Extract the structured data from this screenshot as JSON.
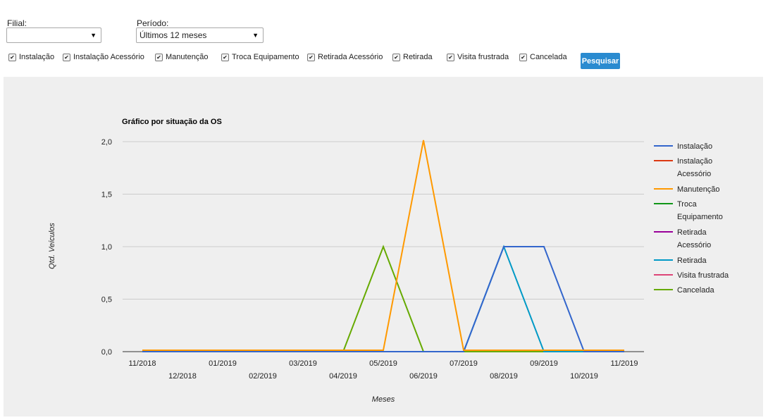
{
  "filters": {
    "filial_label": "Filial:",
    "filial_value": "",
    "periodo_label": "Período:",
    "periodo_value": "Últimos 12 meses"
  },
  "checkboxes": [
    {
      "label": "Instalação",
      "checked": true
    },
    {
      "label": "Instalação Acessório",
      "checked": true
    },
    {
      "label": "Manutenção",
      "checked": true
    },
    {
      "label": "Troca Equipamento",
      "checked": true
    },
    {
      "label": "Retirada Acessório",
      "checked": true
    },
    {
      "label": "Retirada",
      "checked": true
    },
    {
      "label": "Visita frustrada",
      "checked": true
    },
    {
      "label": "Cancelada",
      "checked": true
    }
  ],
  "search_button": "Pesquisar",
  "chart_data": {
    "type": "line",
    "title": "Gráfico por situação da OS",
    "xlabel": "Meses",
    "ylabel": "Qtd. Veículos",
    "categories": [
      "11/2018",
      "12/2018",
      "01/2019",
      "02/2019",
      "03/2019",
      "04/2019",
      "05/2019",
      "06/2019",
      "07/2019",
      "08/2019",
      "09/2019",
      "10/2019",
      "11/2019"
    ],
    "yticks": [
      "0,0",
      "0,5",
      "1,0",
      "1,5",
      "2,0"
    ],
    "ylim": [
      0,
      2
    ],
    "grid": true,
    "legend_position": "right",
    "series": [
      {
        "name": "Instalação",
        "legend_lines": [
          "Instalação"
        ],
        "color": "#3366cc",
        "values": [
          0,
          0,
          0,
          0,
          0,
          0,
          0,
          0,
          0,
          1,
          1,
          0,
          0
        ]
      },
      {
        "name": "Instalação Acessório",
        "legend_lines": [
          "Instalação",
          "Acessório"
        ],
        "color": "#dc3912",
        "values": [
          0,
          0,
          0,
          0,
          0,
          0,
          0,
          0,
          0,
          0,
          0,
          0,
          0
        ]
      },
      {
        "name": "Manutenção",
        "legend_lines": [
          "Manutenção"
        ],
        "color": "#ff9900",
        "values": [
          0,
          0,
          0,
          0,
          0,
          0,
          0,
          2,
          0,
          0,
          0,
          0,
          0
        ]
      },
      {
        "name": "Troca Equipamento",
        "legend_lines": [
          "Troca",
          "Equipamento"
        ],
        "color": "#109618",
        "values": [
          0,
          0,
          0,
          0,
          0,
          0,
          0,
          0,
          0,
          0,
          0,
          0,
          0
        ]
      },
      {
        "name": "Retirada Acessório",
        "legend_lines": [
          "Retirada",
          "Acessório"
        ],
        "color": "#990099",
        "values": [
          0,
          0,
          0,
          0,
          0,
          0,
          0,
          0,
          0,
          0,
          0,
          0,
          0
        ]
      },
      {
        "name": "Retirada",
        "legend_lines": [
          "Retirada"
        ],
        "color": "#0099c6",
        "values": [
          0,
          0,
          0,
          0,
          0,
          0,
          0,
          0,
          0,
          1,
          0,
          0,
          0
        ]
      },
      {
        "name": "Visita frustrada",
        "legend_lines": [
          "Visita frustrada"
        ],
        "color": "#dd4477",
        "values": [
          0,
          0,
          0,
          0,
          0,
          0,
          0,
          0,
          0,
          0,
          0,
          0,
          0
        ]
      },
      {
        "name": "Cancelada",
        "legend_lines": [
          "Cancelada"
        ],
        "color": "#66aa00",
        "values": [
          0,
          0,
          0,
          0,
          0,
          0,
          1,
          0,
          0,
          0,
          0,
          0,
          0
        ]
      }
    ]
  }
}
